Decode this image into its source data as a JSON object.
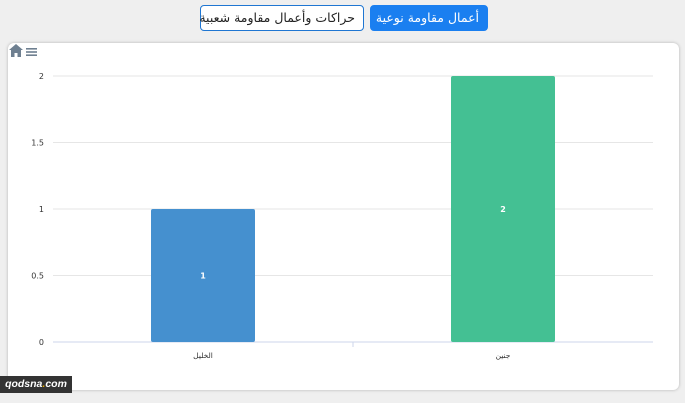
{
  "toolbar": {
    "buttons": [
      {
        "label": "حراكات وأعمال مقاومة شعبية",
        "active": false
      },
      {
        "label": "أعمال مقاومة نوعية",
        "active": true
      }
    ]
  },
  "chart_icons": [
    "home-icon",
    "menu-icon"
  ],
  "colors": {
    "primary": "#1a7ff0",
    "bar_1": "#4590cf",
    "bar_2": "#44c093"
  },
  "chart_data": {
    "type": "bar",
    "categories": [
      "الخليل",
      "جنين"
    ],
    "values": [
      1,
      2
    ],
    "data_labels": [
      "1",
      "2"
    ],
    "bar_colors": [
      "#4590cf",
      "#44c093"
    ],
    "ylim": [
      0,
      2
    ],
    "yticks": [
      0,
      0.5,
      1,
      1.5,
      2
    ],
    "ytick_labels": [
      "0",
      "0.5",
      "1",
      "1.5",
      "2"
    ],
    "grid": true,
    "title": "",
    "xlabel": "",
    "ylabel": ""
  },
  "watermark": {
    "brand": "qodsna",
    "dot": ".",
    "tld": "com"
  }
}
